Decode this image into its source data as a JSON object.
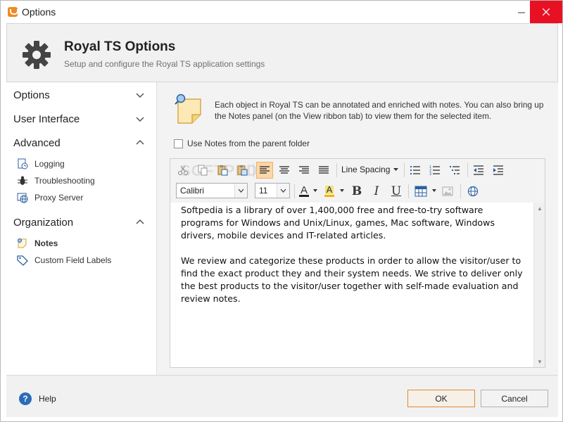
{
  "window": {
    "title": "Options"
  },
  "header": {
    "title": "Royal TS Options",
    "subtitle": "Setup and configure the Royal TS application settings"
  },
  "sidebar": {
    "sections": [
      {
        "label": "Options",
        "expanded": false,
        "items": []
      },
      {
        "label": "User Interface",
        "expanded": false,
        "items": []
      },
      {
        "label": "Advanced",
        "expanded": true,
        "items": [
          {
            "label": "Logging",
            "icon": "logging-icon"
          },
          {
            "label": "Troubleshooting",
            "icon": "bug-icon"
          },
          {
            "label": "Proxy Server",
            "icon": "globe-icon"
          }
        ]
      },
      {
        "label": "Organization",
        "expanded": true,
        "items": [
          {
            "label": "Notes",
            "icon": "note-icon",
            "selected": true
          },
          {
            "label": "Custom Field Labels",
            "icon": "tag-icon"
          }
        ]
      }
    ]
  },
  "main": {
    "description": "Each object in Royal TS can be annotated and enriched with notes. You can also bring up the Notes panel (on the View ribbon tab) to view them for the selected item.",
    "use_parent_label": "Use Notes from the parent folder",
    "use_parent_checked": false,
    "toolbar": {
      "line_spacing_label": "Line Spacing",
      "font_name": "Calibri",
      "font_size": "11",
      "bold": "B",
      "italic": "I",
      "underline": "U",
      "font_color_letter": "A",
      "highlight_letter": "A",
      "watermark": "SOFTPEDIA"
    },
    "content": {
      "paragraphs": [
        "Softpedia is a library of over 1,400,000 free and free-to-try software programs for Windows and Unix/Linux, games, Mac software, Windows drivers, mobile devices and IT-related articles.",
        "We review and categorize these products in order to allow the visitor/user to find the exact product they and their system needs. We strive to deliver only the best products to the visitor/user together with self-made evaluation and review notes."
      ]
    }
  },
  "footer": {
    "help_label": "Help",
    "ok_label": "OK",
    "cancel_label": "Cancel"
  },
  "colors": {
    "accent": "#e08b2e",
    "highlight": "#fbd7a9",
    "help_blue": "#2b6cb7",
    "close_red": "#e81123"
  }
}
